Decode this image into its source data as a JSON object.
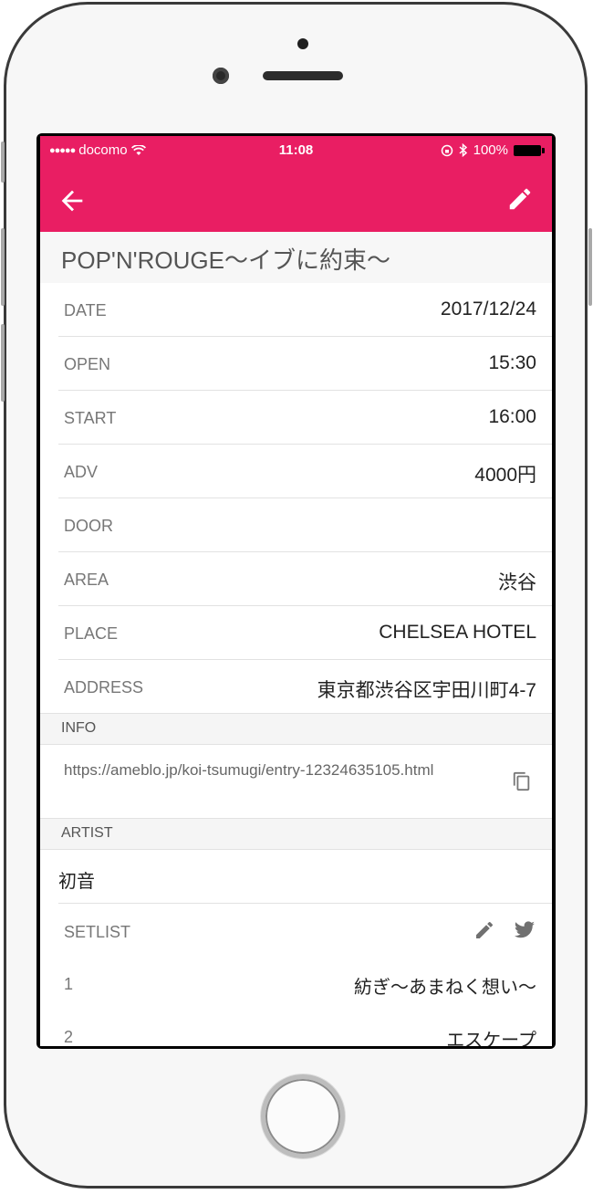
{
  "status_bar": {
    "carrier": "docomo",
    "time": "11:08",
    "battery": "100%"
  },
  "app_bar": {
    "back_icon": "arrow-left-icon",
    "edit_icon": "pencil-icon",
    "color": "#e91e63"
  },
  "event": {
    "title": "POP'N'ROUGE〜イブに約束〜",
    "details": [
      {
        "label": "DATE",
        "value": "2017/12/24"
      },
      {
        "label": "OPEN",
        "value": "15:30"
      },
      {
        "label": "START",
        "value": "16:00"
      },
      {
        "label": "ADV",
        "value": "4000円"
      },
      {
        "label": "DOOR",
        "value": ""
      },
      {
        "label": "AREA",
        "value": "渋谷"
      },
      {
        "label": "PLACE",
        "value": "CHELSEA HOTEL"
      },
      {
        "label": "ADDRESS",
        "value": "東京都渋谷区宇田川町4-7"
      }
    ]
  },
  "info": {
    "heading": "INFO",
    "link": "https://ameblo.jp/koi-tsumugi/entry-12324635105.html",
    "copy_icon": "copy-icon"
  },
  "artist": {
    "heading": "ARTIST",
    "name": "初音"
  },
  "setlist": {
    "label": "SETLIST",
    "edit_icon": "pencil-icon",
    "share_icon": "twitter-icon",
    "songs": [
      {
        "num": "1",
        "title": "紡ぎ〜あまねく想い〜"
      },
      {
        "num": "2",
        "title": "エスケープ"
      }
    ]
  }
}
